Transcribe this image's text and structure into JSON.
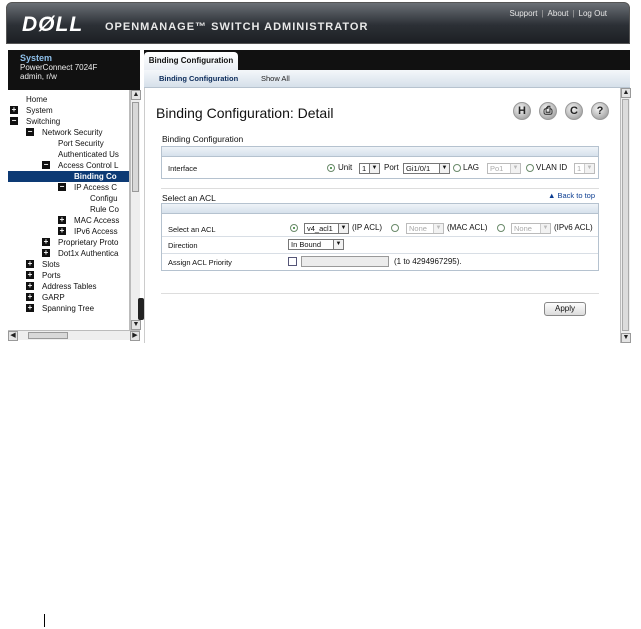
{
  "header": {
    "logo": "DØLL",
    "product": "OPENMANAGE™ SWITCH ADMINISTRATOR",
    "links": [
      "Support",
      "About",
      "Log Out"
    ]
  },
  "sidebar": {
    "system_title": "System",
    "device": "PowerConnect 7024F",
    "user": "admin, r/w",
    "tree": [
      {
        "label": "Home",
        "level": 0,
        "icon": "none"
      },
      {
        "label": "System",
        "level": 0,
        "icon": "plus"
      },
      {
        "label": "Switching",
        "level": 0,
        "icon": "minus"
      },
      {
        "label": "Network Security",
        "level": 1,
        "icon": "minus"
      },
      {
        "label": "Port Security",
        "level": 2,
        "icon": "none"
      },
      {
        "label": "Authenticated Us",
        "level": 2,
        "icon": "none"
      },
      {
        "label": "Access Control L",
        "level": 2,
        "icon": "minus"
      },
      {
        "label": "Binding Co",
        "level": 3,
        "icon": "none",
        "selected": true
      },
      {
        "label": "IP Access C",
        "level": 3,
        "icon": "minus"
      },
      {
        "label": "Configu",
        "level": 4,
        "icon": "none"
      },
      {
        "label": "Rule Co",
        "level": 4,
        "icon": "none"
      },
      {
        "label": "MAC Access",
        "level": 3,
        "icon": "plus"
      },
      {
        "label": "IPv6 Access",
        "level": 3,
        "icon": "plus"
      },
      {
        "label": "Proprietary Proto",
        "level": 2,
        "icon": "plus"
      },
      {
        "label": "Dot1x Authentica",
        "level": 2,
        "icon": "plus"
      },
      {
        "label": "Slots",
        "level": 1,
        "icon": "plus"
      },
      {
        "label": "Ports",
        "level": 1,
        "icon": "plus"
      },
      {
        "label": "Address Tables",
        "level": 1,
        "icon": "plus"
      },
      {
        "label": "GARP",
        "level": 1,
        "icon": "plus"
      },
      {
        "label": "Spanning Tree",
        "level": 1,
        "icon": "plus"
      }
    ]
  },
  "main": {
    "tab": "Binding Configuration",
    "subtabs": [
      "Binding Configuration",
      "Show All"
    ],
    "title": "Binding Configuration: Detail",
    "toolbar_icons": [
      "save-icon",
      "print-icon",
      "refresh-icon",
      "help-icon"
    ],
    "toolbar_glyphs": [
      "H",
      "⎙",
      "C",
      "?"
    ],
    "binding_section": {
      "label": "Binding Configuration",
      "interface_label": "Interface",
      "unit_label": "Unit",
      "unit_value": "1",
      "port_label": "Port",
      "port_value": "Gi1/0/1",
      "lag_label": "LAG",
      "lag_value": "Po1",
      "vlan_label": "VLAN ID",
      "vlan_value": "1"
    },
    "acl_section": {
      "label": "Select an ACL",
      "back_to_top": "▲ Back to top",
      "select_acl_label": "Select an ACL",
      "ip_acl_value": "v4_acl1",
      "ip_acl_label": "(IP ACL)",
      "mac_acl_value": "None",
      "mac_acl_label": "(MAC ACL)",
      "ipv6_acl_value": "None",
      "ipv6_acl_label": "(IPv6 ACL)",
      "direction_label": "Direction",
      "direction_value": "In Bound",
      "priority_label": "Assign ACL Priority",
      "priority_range": "(1 to 4294967295)."
    },
    "apply_label": "Apply"
  }
}
